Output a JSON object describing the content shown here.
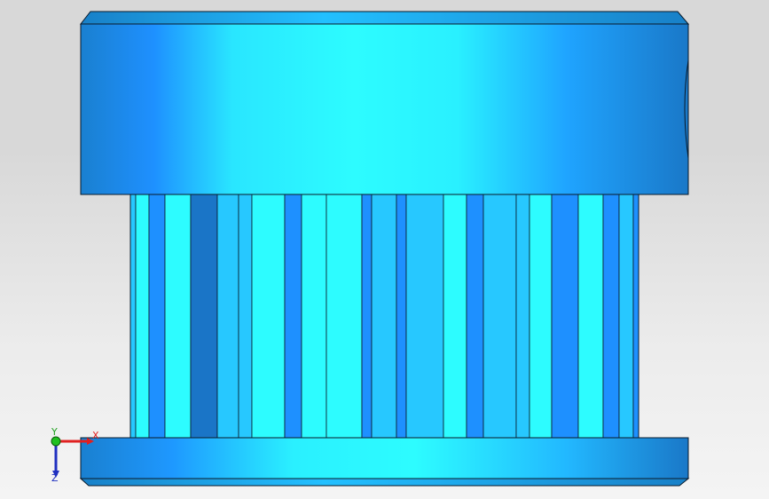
{
  "viewport": {
    "background": "#e6e6e6"
  },
  "model": {
    "name_icon": "pulley-part-3d",
    "colors": {
      "shade_dark": "#1a75c7",
      "shade_mid": "#1e90ff",
      "shade_light": "#27c8ff",
      "highlight": "#2dfcff",
      "edge": "#0a1a2a"
    }
  },
  "triad": {
    "x_label": "X",
    "y_label": "Y",
    "z_label": "Z",
    "x_color": "#e02020",
    "y_color": "#20c020",
    "z_color": "#2030c0"
  }
}
